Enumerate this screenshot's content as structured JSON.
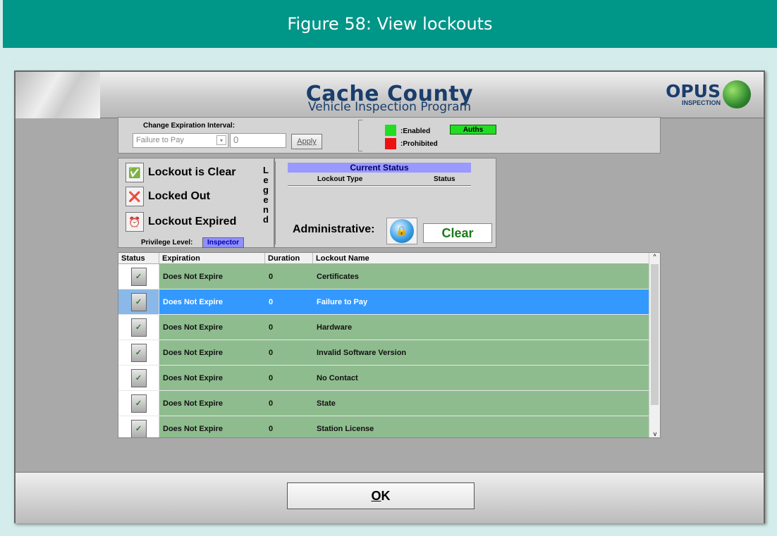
{
  "figure": {
    "caption": "Figure 58: View lockouts"
  },
  "banner": {
    "title": "Cache County",
    "subtitle": "Vehicle Inspection Program",
    "logo_main": "OPUS",
    "logo_sub": "INSPECTION"
  },
  "expiration": {
    "label": "Change Expiration Interval:",
    "selected": "Failure to Pay",
    "value": "0",
    "apply_label": "Apply"
  },
  "auth_legend": {
    "enabled_label": ":Enabled",
    "prohibited_label": ":Prohibited",
    "auths_label": "Auths",
    "enabled_color": "#22dd22",
    "prohibited_color": "#ee1111"
  },
  "legend": {
    "clear_label": "Lockout is Clear",
    "locked_label": "Locked Out",
    "expired_label": "Lockout Expired",
    "vertical_title": [
      "L",
      "e",
      "g",
      "e",
      "n",
      "d"
    ],
    "privilege_label": "Privilege Level:",
    "privilege_value": "Inspector"
  },
  "current_status": {
    "title": "Current Status",
    "col_type": "Lockout Type",
    "col_status": "Status",
    "admin_label": "Administrative:",
    "admin_value": "Clear"
  },
  "table": {
    "headers": {
      "status": "Status",
      "expiration": "Expiration",
      "duration": "Duration",
      "name": "Lockout Name"
    },
    "rows": [
      {
        "expiration": "Does Not Expire",
        "duration": "0",
        "name": "Certificates"
      },
      {
        "expiration": "Does Not Expire",
        "duration": "0",
        "name": "Failure to Pay"
      },
      {
        "expiration": "Does Not Expire",
        "duration": "0",
        "name": "Hardware"
      },
      {
        "expiration": "Does Not Expire",
        "duration": "0",
        "name": "Invalid Software Version"
      },
      {
        "expiration": "Does Not Expire",
        "duration": "0",
        "name": "No Contact"
      },
      {
        "expiration": "Does Not Expire",
        "duration": "0",
        "name": "State"
      },
      {
        "expiration": "Does Not Expire",
        "duration": "0",
        "name": "Station License"
      }
    ]
  },
  "footer": {
    "ok_label": "OK"
  }
}
